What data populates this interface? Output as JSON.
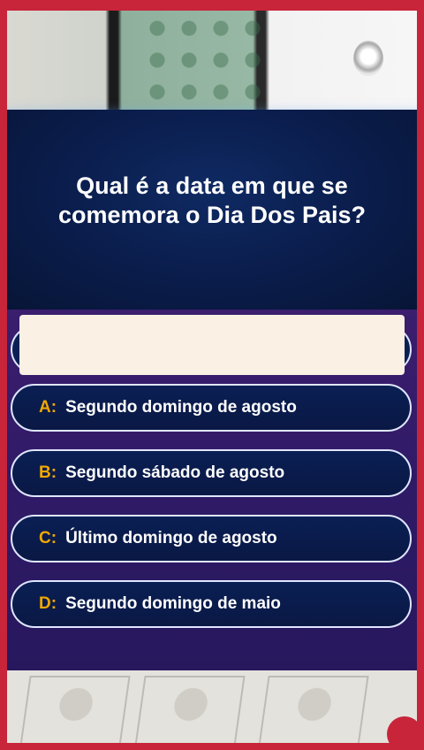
{
  "question": {
    "line1": "Qual é a data em que se",
    "line2": "comemora o Dia Dos Pais?"
  },
  "answers": [
    {
      "letter": "A:",
      "text": "Segundo domingo de agosto"
    },
    {
      "letter": "B:",
      "text": "Segundo sábado de agosto"
    },
    {
      "letter": "C:",
      "text": "Último domingo de agosto"
    },
    {
      "letter": "D:",
      "text": "Segundo domingo de maio"
    }
  ],
  "colors": {
    "frame": "#c8243a",
    "question_bg": "#0a1c4a",
    "answers_bg": "#2f1a66",
    "letter": "#f0a800",
    "answer_text": "#ffffff"
  }
}
